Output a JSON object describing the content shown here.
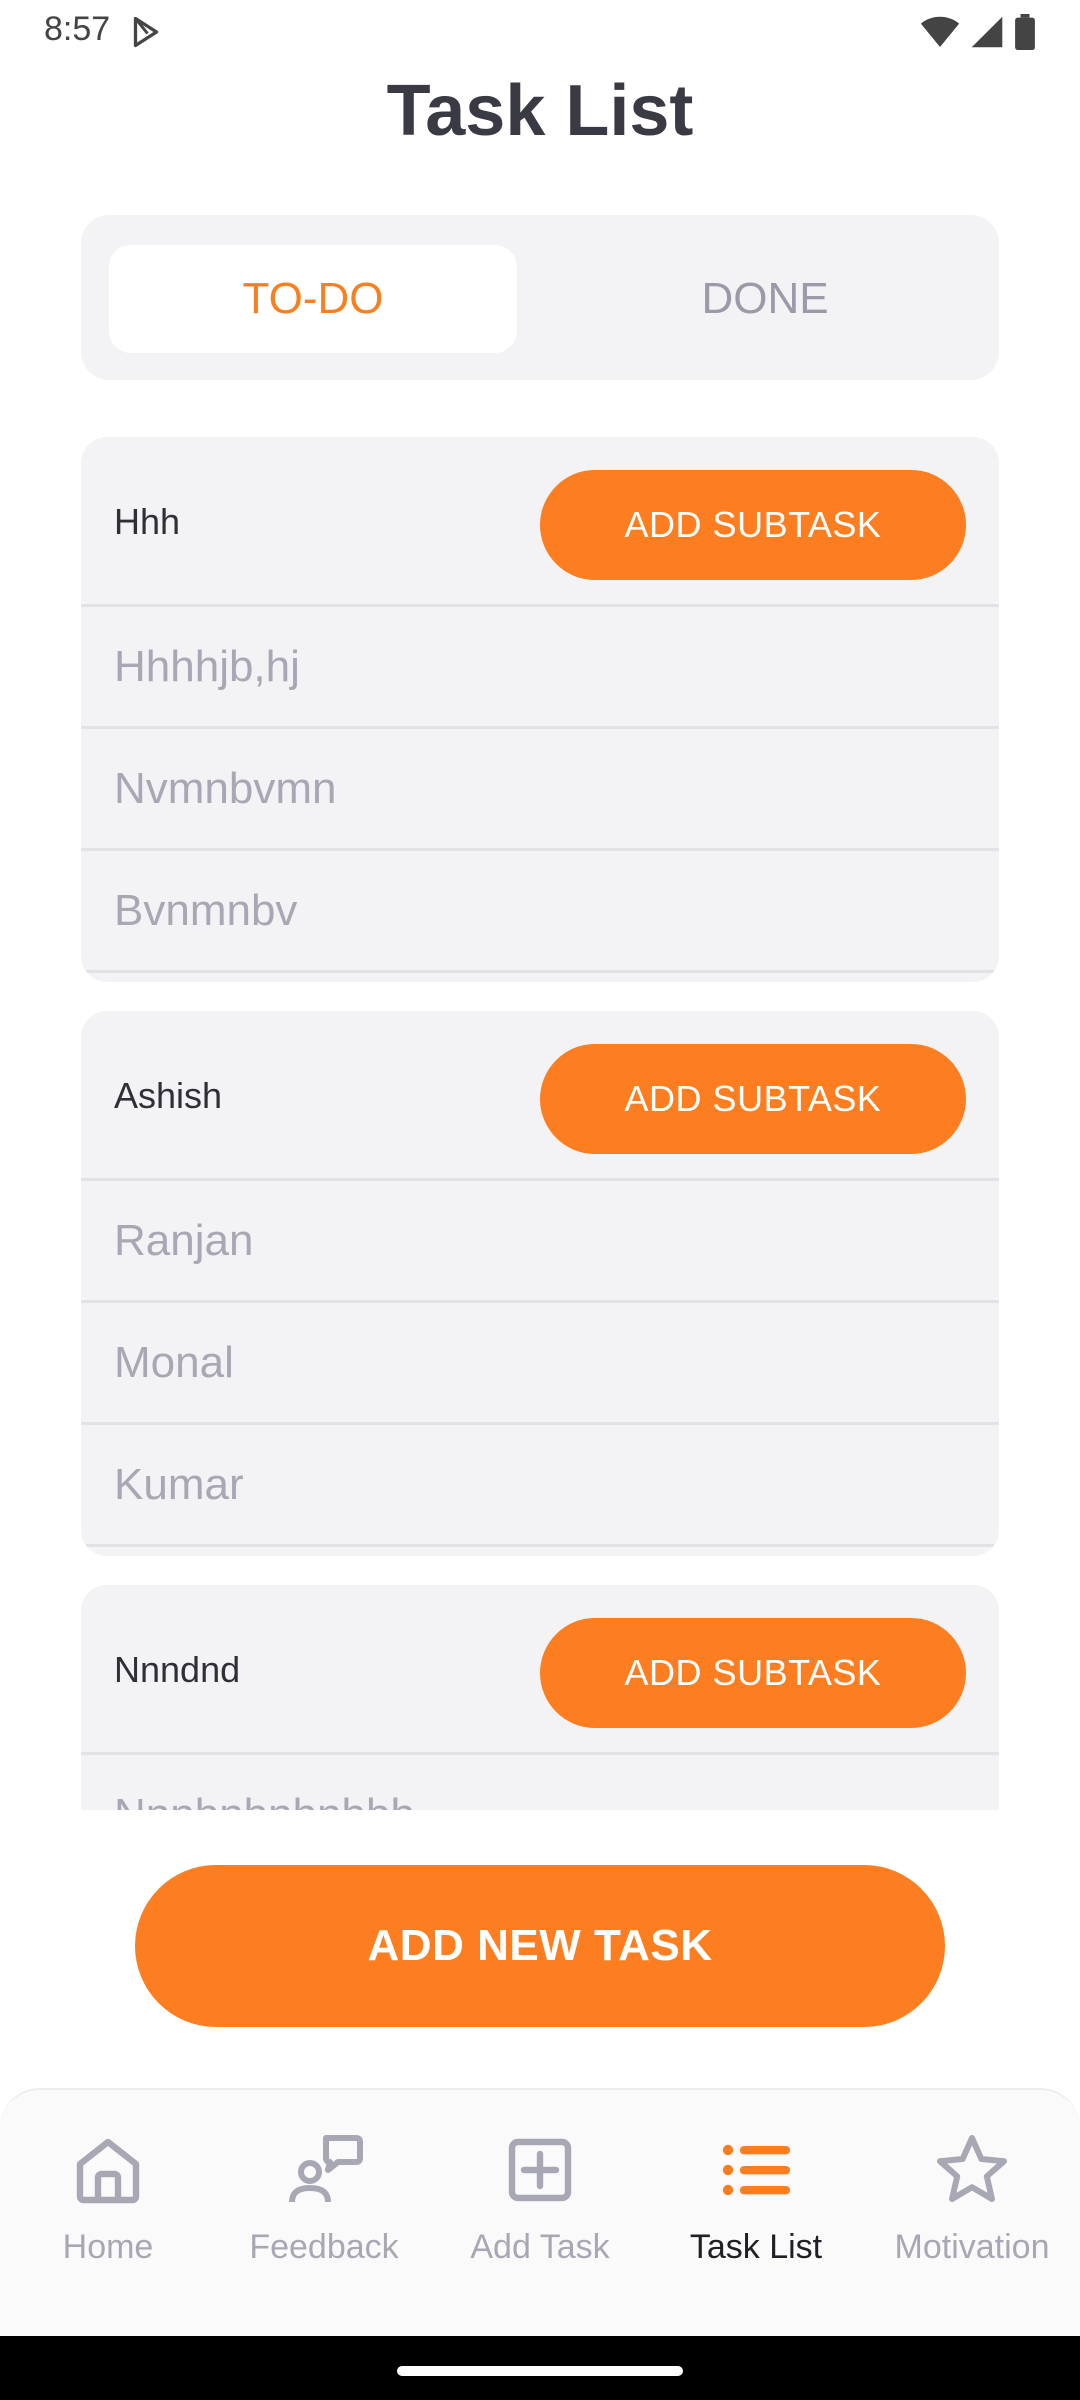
{
  "status_bar": {
    "time": "8:57"
  },
  "header": {
    "title": "Task List"
  },
  "tabs": [
    {
      "label": "TO-DO",
      "active": true
    },
    {
      "label": "DONE",
      "active": false
    }
  ],
  "tasks": [
    {
      "title": "Hhh",
      "add_subtask_label": "ADD SUBTASK",
      "subtasks": [
        "Hhhhjb,hj",
        "Nvmnbvmn",
        "Bvnmnbv"
      ]
    },
    {
      "title": "Ashish",
      "add_subtask_label": "ADD SUBTASK",
      "subtasks": [
        "Ranjan",
        "Monal",
        "Kumar"
      ]
    },
    {
      "title": "Nnndnd",
      "add_subtask_label": "ADD SUBTASK",
      "subtasks": [
        "Nnnbnbnbnbbb"
      ]
    }
  ],
  "add_new_task_label": "ADD NEW TASK",
  "bottom_nav": [
    {
      "label": "Home",
      "icon": "home-icon",
      "active": false
    },
    {
      "label": "Feedback",
      "icon": "feedback-icon",
      "active": false
    },
    {
      "label": "Add Task",
      "icon": "add-task-icon",
      "active": false
    },
    {
      "label": "Task List",
      "icon": "task-list-icon",
      "active": true
    },
    {
      "label": "Motivation",
      "icon": "star-icon",
      "active": false
    }
  ],
  "colors": {
    "accent": "#fd7e20",
    "muted": "#a8a8b4",
    "card_bg": "#f3f3f5"
  }
}
